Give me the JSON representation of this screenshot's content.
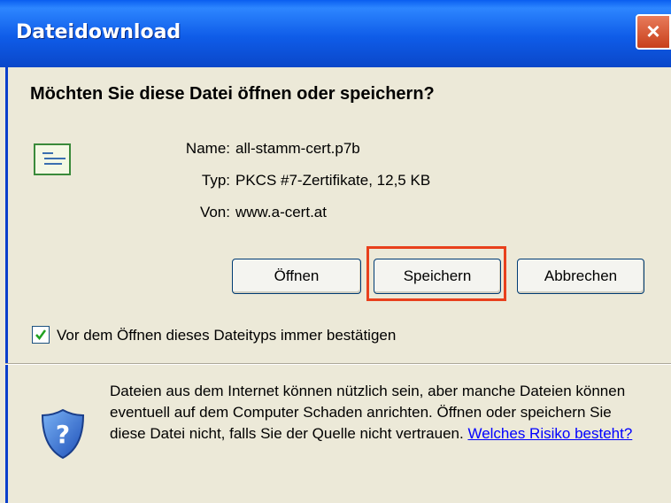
{
  "window": {
    "title": "Dateidownload"
  },
  "close_icon": "×",
  "question": "Möchten Sie diese Datei öffnen oder speichern?",
  "file": {
    "name_label": "Name:",
    "name_value": "all-stamm-cert.p7b",
    "type_label": "Typ:",
    "type_value": "PKCS #7-Zertifikate, 12,5 KB",
    "from_label": "Von:",
    "from_value": "www.a-cert.at"
  },
  "buttons": {
    "open": "Öffnen",
    "save": "Speichern",
    "cancel": "Abbrechen"
  },
  "checkbox": {
    "label": "Vor dem Öffnen dieses Dateityps immer bestätigen",
    "checked": true
  },
  "warning": {
    "text": "Dateien aus dem Internet können nützlich sein, aber manche Dateien können eventuell auf dem Computer Schaden anrichten. Öffnen oder speichern Sie diese Datei nicht, falls Sie der Quelle nicht vertrauen.",
    "link": "Welches Risiko besteht?"
  },
  "colors": {
    "titlebar": "#0A5EF0",
    "highlight": "#E8401C",
    "face": "#ECE9D8"
  }
}
